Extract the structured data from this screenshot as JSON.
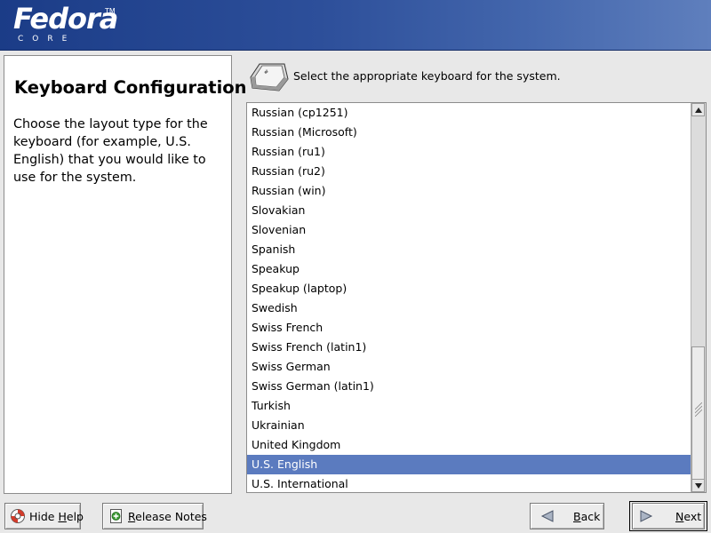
{
  "header": {
    "logo_text": "Fedora",
    "logo_subtext": "CORE",
    "logo_tm": "TM"
  },
  "help": {
    "title": "Keyboard Configuration",
    "body": "Choose the layout type for the keyboard (for example, U.S. English) that you would like to use for the system."
  },
  "prompt": "Select the appropriate keyboard for the system.",
  "icons": {
    "prompt": "keyboard-key-icon",
    "hide_help": "lifebuoy-icon",
    "release_notes": "notes-add-icon",
    "back": "back-arrow-icon",
    "next": "next-arrow-icon"
  },
  "keyboard_list": {
    "selected": "U.S. English",
    "items": [
      "Russian (cp1251)",
      "Russian (Microsoft)",
      "Russian (ru1)",
      "Russian (ru2)",
      "Russian (win)",
      "Slovakian",
      "Slovenian",
      "Spanish",
      "Speakup",
      "Speakup (laptop)",
      "Swedish",
      "Swiss French",
      "Swiss French (latin1)",
      "Swiss German",
      "Swiss German (latin1)",
      "Turkish",
      "Ukrainian",
      "United Kingdom",
      "U.S. English",
      "U.S. International"
    ]
  },
  "buttons": {
    "hide_help_pre": "Hide ",
    "hide_help_mnemonic": "H",
    "hide_help_post": "elp",
    "release_notes_mnemonic": "R",
    "release_notes_post": "elease Notes",
    "back_mnemonic": "B",
    "back_post": "ack",
    "next_mnemonic": "N",
    "next_post": "ext"
  },
  "colors": {
    "header_start": "#1b3c87",
    "header_end": "#5f7fbd",
    "selection": "#5b7bbf",
    "background": "#e8e8e8"
  }
}
